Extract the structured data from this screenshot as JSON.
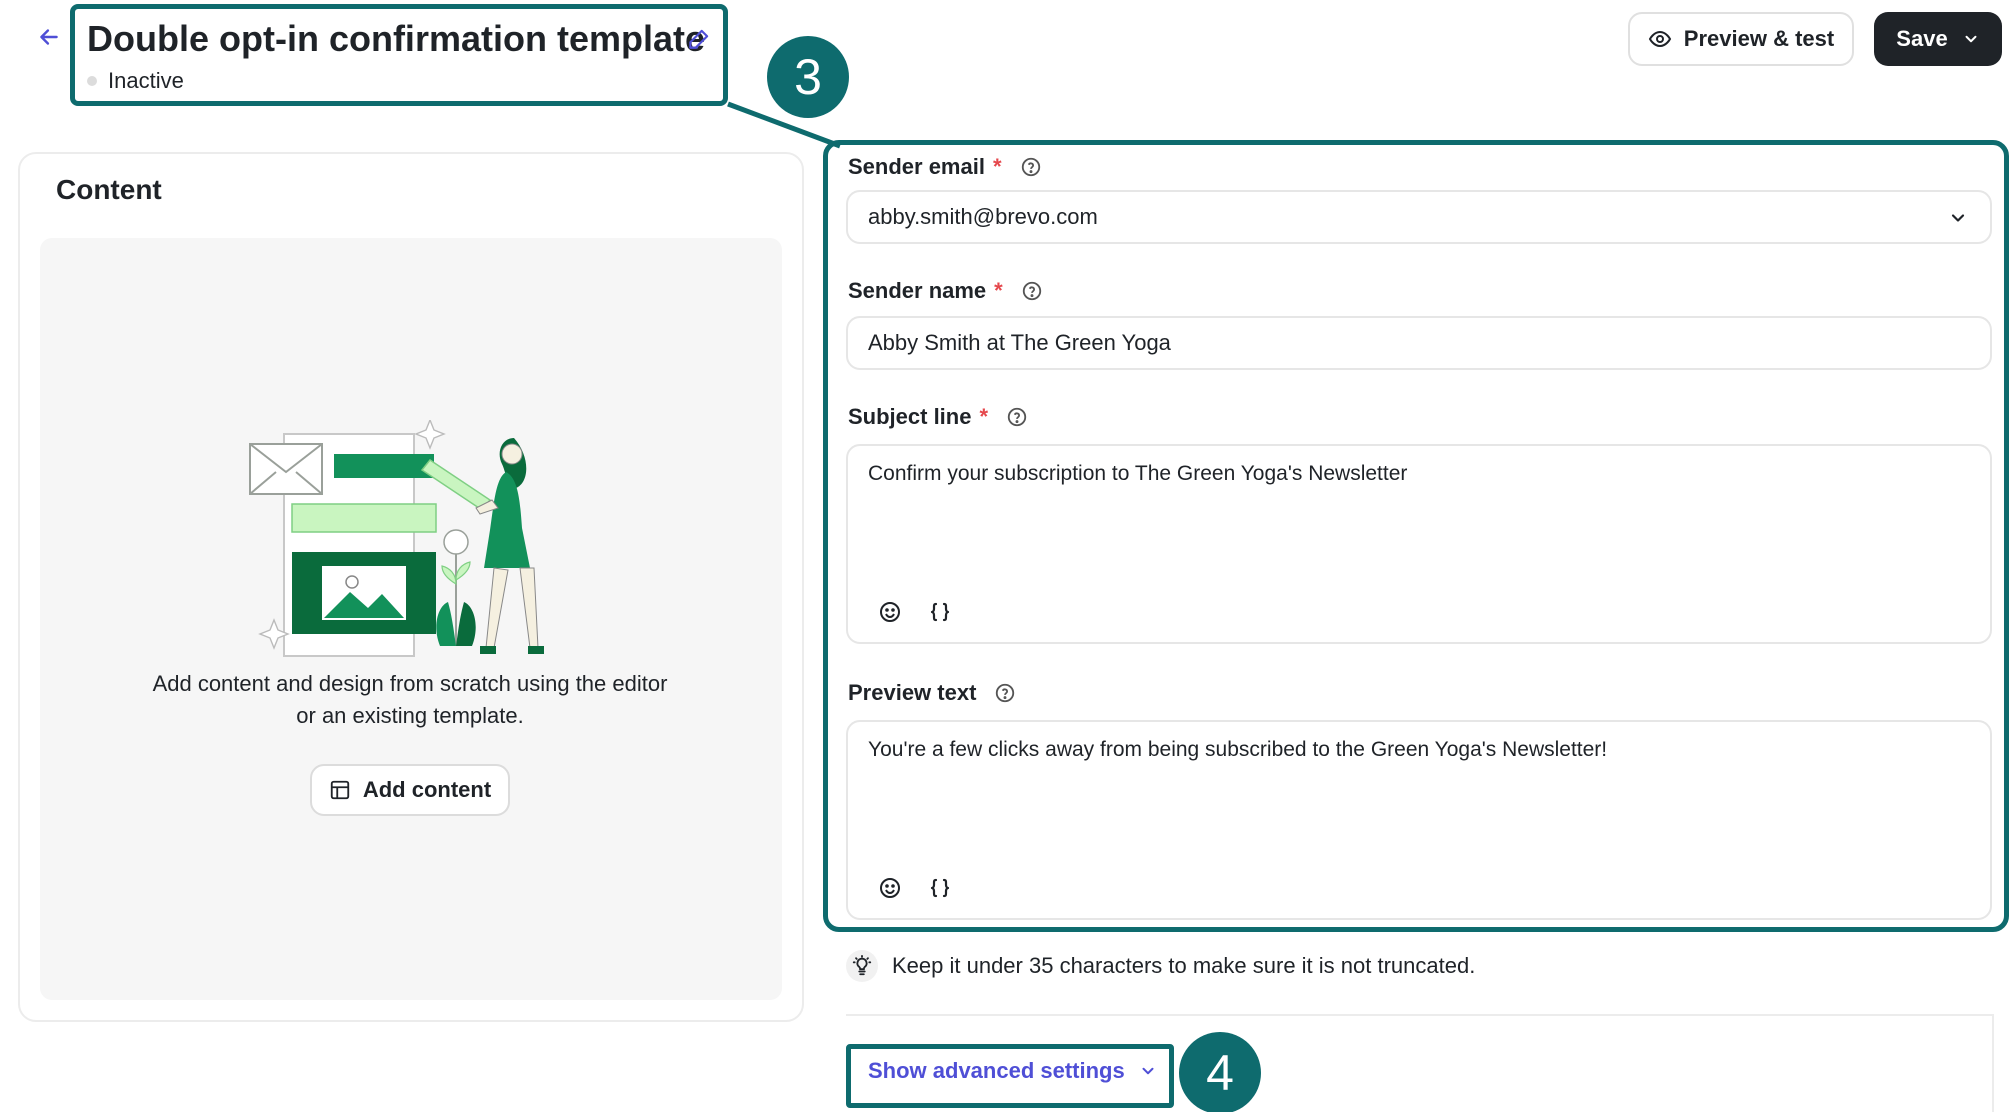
{
  "header": {
    "title": "Double opt-in confirmation template",
    "status": "Inactive",
    "preview_label": "Preview & test",
    "save_label": "Save"
  },
  "callouts": {
    "three": "3",
    "four": "4"
  },
  "content": {
    "heading": "Content",
    "description": "Add content and design from scratch using the editor or an existing template.",
    "add_label": "Add content"
  },
  "form": {
    "sender_email": {
      "label": "Sender email",
      "required": "*",
      "value": "abby.smith@brevo.com"
    },
    "sender_name": {
      "label": "Sender name",
      "required": "*",
      "value": "Abby Smith at The Green Yoga"
    },
    "subject_line": {
      "label": "Subject line",
      "required": "*",
      "value": "Confirm your subscription to The Green Yoga's Newsletter"
    },
    "preview_text": {
      "label": "Preview text",
      "value": "You're a few clicks away from being subscribed to the Green Yoga's Newsletter!"
    },
    "hint": "Keep it under 35 characters to make sure it is not truncated.",
    "advanced_label": "Show advanced settings"
  },
  "colors": {
    "highlight": "#0e6b6e",
    "accent": "#4f4fd6",
    "required": "#e5484d",
    "brand_green": "#12915a"
  },
  "icons": [
    "back-arrow-icon",
    "pencil-icon",
    "eye-icon",
    "chevron-down-icon",
    "help-icon",
    "emoji-icon",
    "braces-icon",
    "lightbulb-icon",
    "layout-icon"
  ]
}
